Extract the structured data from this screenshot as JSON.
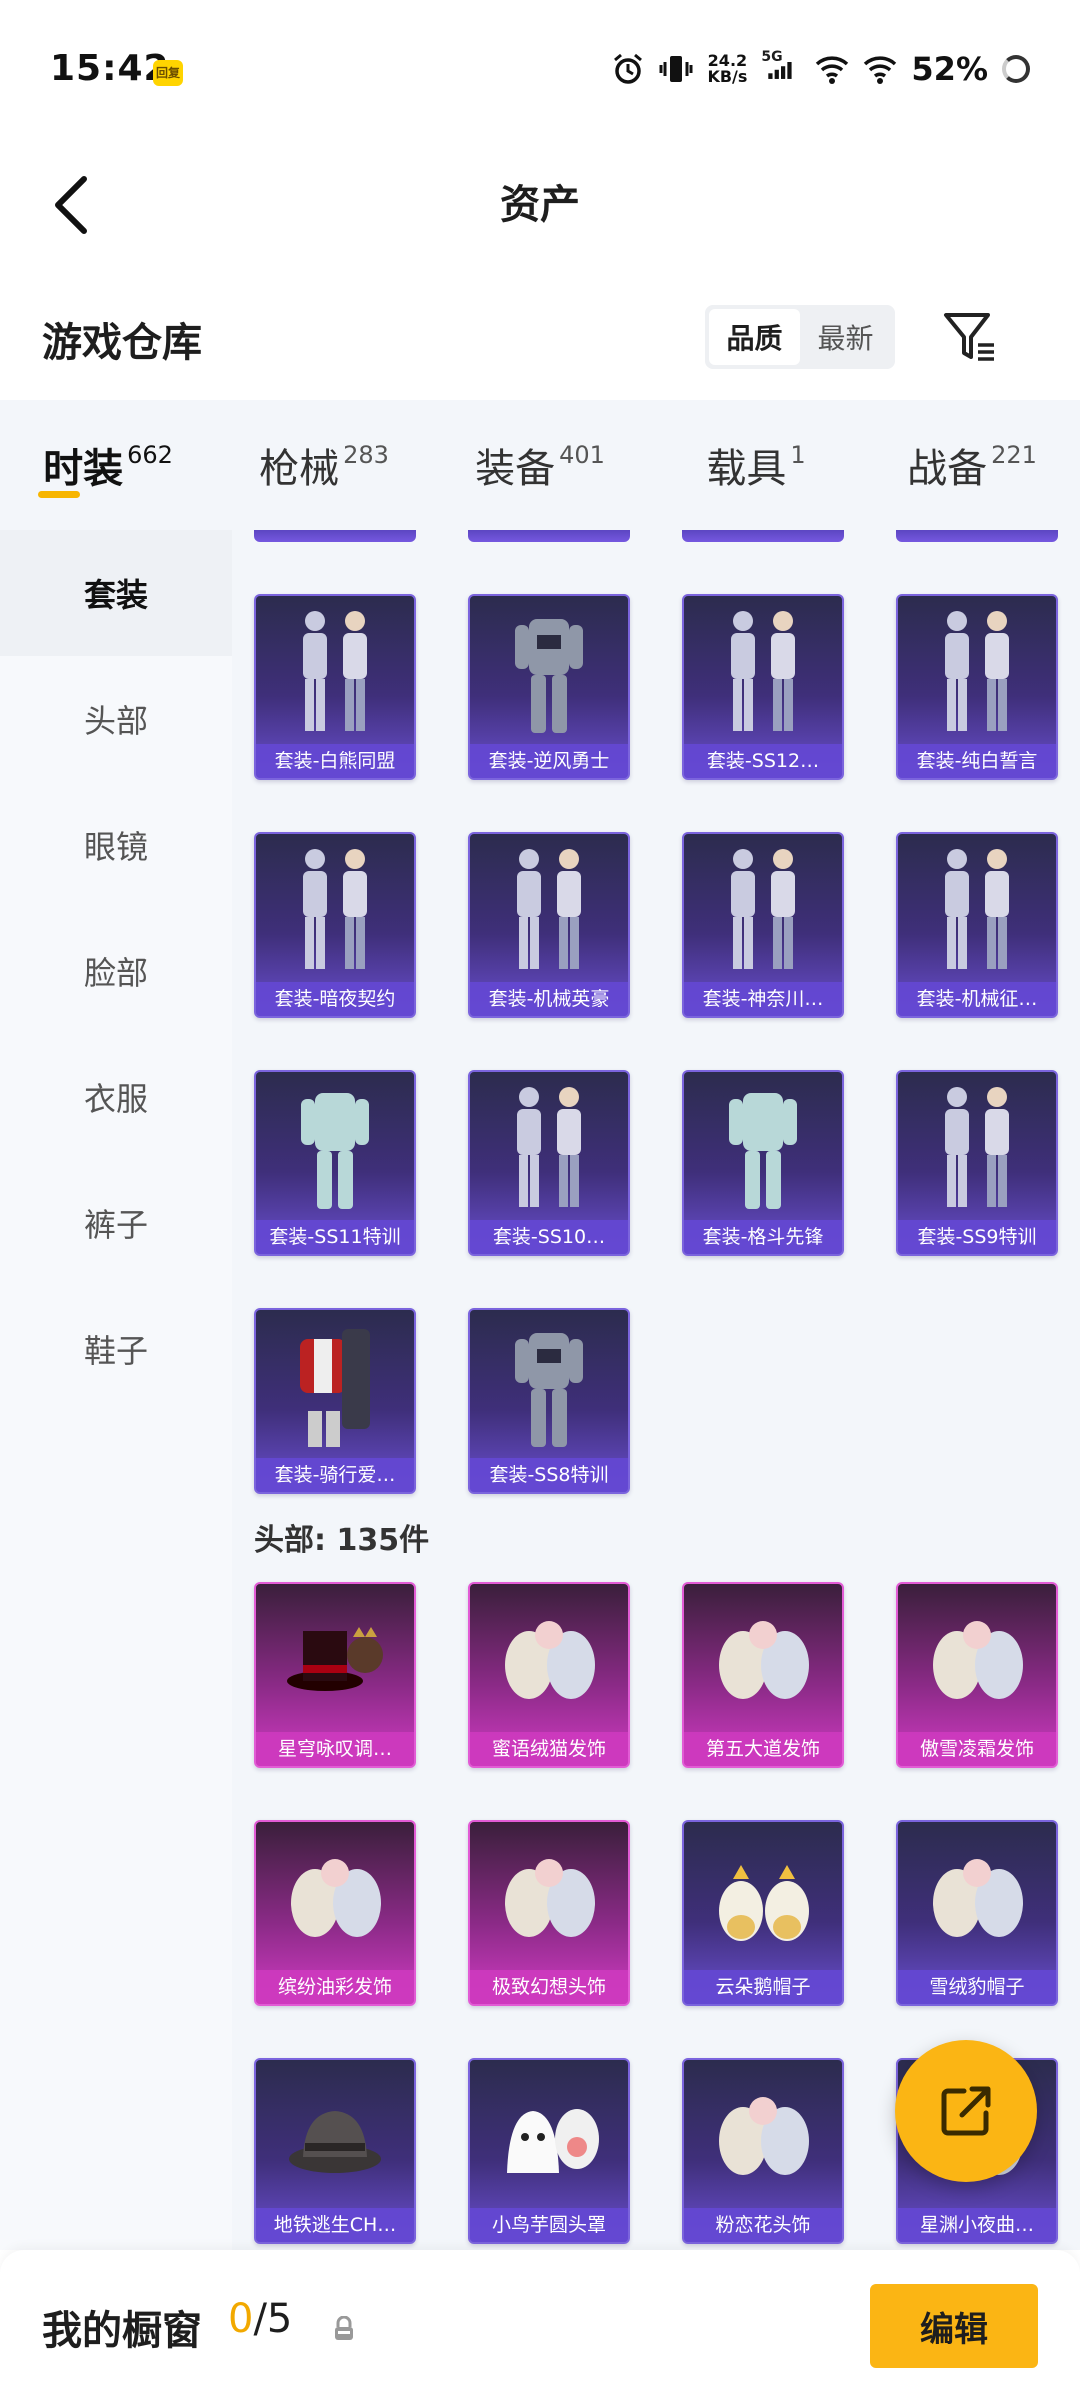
{
  "status_bar": {
    "time": "15:42",
    "app_badge": "回复",
    "net_speed_value": "24.2",
    "net_speed_unit": "KB/s",
    "network_type": "5G",
    "battery": "52%"
  },
  "header": {
    "title": "资产"
  },
  "warehouse": {
    "title": "游戏仓库",
    "sort_options": [
      {
        "label": "品质",
        "active": true
      },
      {
        "label": "最新",
        "active": false
      }
    ]
  },
  "tabs": [
    {
      "label": "时装",
      "count": "662",
      "active": true
    },
    {
      "label": "枪械",
      "count": "283",
      "active": false
    },
    {
      "label": "装备",
      "count": "401",
      "active": false
    },
    {
      "label": "载具",
      "count": "1",
      "active": false
    },
    {
      "label": "战备",
      "count": "221",
      "active": false
    }
  ],
  "sidebar": {
    "items": [
      {
        "label": "套装",
        "active": true
      },
      {
        "label": "头部",
        "active": false
      },
      {
        "label": "眼镜",
        "active": false
      },
      {
        "label": "脸部",
        "active": false
      },
      {
        "label": "衣服",
        "active": false
      },
      {
        "label": "裤子",
        "active": false
      },
      {
        "label": "鞋子",
        "active": false
      }
    ]
  },
  "suits": [
    {
      "name": "套装-白熊同盟",
      "rarity": "purple",
      "icon": "outfit-duo-icon"
    },
    {
      "name": "套装-逆风勇士",
      "rarity": "purple",
      "icon": "outfit-armor-icon"
    },
    {
      "name": "套装-SS12…",
      "rarity": "purple",
      "icon": "outfit-duo-icon"
    },
    {
      "name": "套装-纯白誓言",
      "rarity": "purple",
      "icon": "outfit-duo-icon"
    },
    {
      "name": "套装-暗夜契约",
      "rarity": "purple",
      "icon": "outfit-duo-icon"
    },
    {
      "name": "套装-机械英豪",
      "rarity": "purple",
      "icon": "outfit-duo-icon"
    },
    {
      "name": "套装-神奈川…",
      "rarity": "purple",
      "icon": "outfit-duo-icon"
    },
    {
      "name": "套装-机械征…",
      "rarity": "purple",
      "icon": "outfit-duo-icon"
    },
    {
      "name": "套装-SS11特训",
      "rarity": "purple",
      "icon": "outfit-single-icon"
    },
    {
      "name": "套装-SS10…",
      "rarity": "purple",
      "icon": "outfit-duo-icon"
    },
    {
      "name": "套装-格斗先锋",
      "rarity": "purple",
      "icon": "outfit-single-icon"
    },
    {
      "name": "套装-SS9特训",
      "rarity": "purple",
      "icon": "outfit-duo-icon"
    },
    {
      "name": "套装-骑行爱…",
      "rarity": "purple",
      "icon": "outfit-jacket-icon"
    },
    {
      "name": "套装-SS8特训",
      "rarity": "purple",
      "icon": "outfit-armor-icon"
    }
  ],
  "head_section": {
    "label": "头部: 135件",
    "items": [
      {
        "name": "星穹咏叹调…",
        "rarity": "pink",
        "icon": "top-hat-icon"
      },
      {
        "name": "蜜语绒猫发饰",
        "rarity": "pink",
        "icon": "hair-accessory-icon"
      },
      {
        "name": "第五大道发饰",
        "rarity": "pink",
        "icon": "hair-accessory-icon"
      },
      {
        "name": "傲雪凌霜发饰",
        "rarity": "pink",
        "icon": "hair-accessory-icon"
      },
      {
        "name": "缤纷油彩发饰",
        "rarity": "pink",
        "icon": "hair-accessory-icon"
      },
      {
        "name": "极致幻想头饰",
        "rarity": "pink",
        "icon": "hair-accessory-icon"
      },
      {
        "name": "云朵鹅帽子",
        "rarity": "purple",
        "icon": "goose-hat-icon"
      },
      {
        "name": "雪绒豹帽子",
        "rarity": "purple",
        "icon": "hair-accessory-icon"
      },
      {
        "name": "地铁逃生CH…",
        "rarity": "purple",
        "icon": "bucket-hat-icon"
      },
      {
        "name": "小鸟芋圆头罩",
        "rarity": "purple",
        "icon": "bird-hood-icon"
      },
      {
        "name": "粉恋花头饰",
        "rarity": "purple",
        "icon": "hair-accessory-icon"
      },
      {
        "name": "星渊小夜曲…",
        "rarity": "purple",
        "icon": "hair-accessory-icon"
      }
    ]
  },
  "bottom_bar": {
    "title": "我的橱窗",
    "showcase_used": "0",
    "showcase_total": "/5",
    "edit_label": "编辑"
  },
  "colors": {
    "accent": "#fbb514",
    "purple_rarity": "#6a4fd0",
    "pink_rarity": "#d13bc3"
  }
}
